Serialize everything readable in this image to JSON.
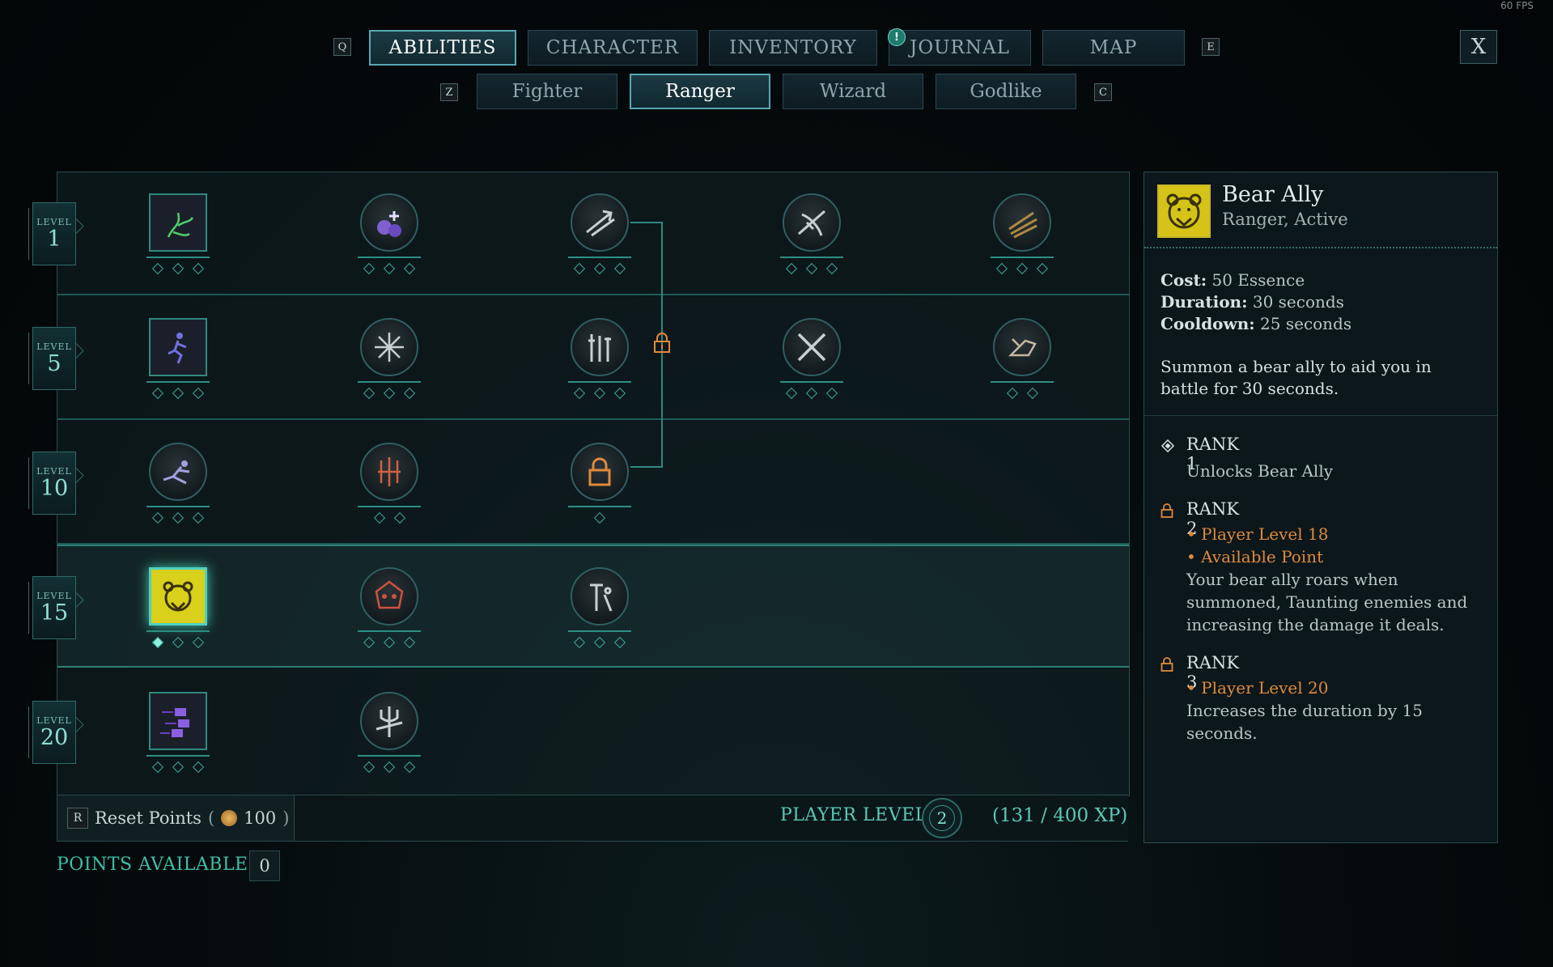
{
  "fps": "60 FPS",
  "top_tabs": {
    "left_key": "Q",
    "right_key": "E",
    "items": [
      "ABILITIES",
      "CHARACTER",
      "INVENTORY",
      "JOURNAL",
      "MAP"
    ],
    "active": "ABILITIES",
    "journal_alert": "!",
    "close_label": "X"
  },
  "class_tabs": {
    "left_key": "Z",
    "right_key": "C",
    "items": [
      "Fighter",
      "Ranger",
      "Wizard",
      "Godlike"
    ],
    "active": "Ranger"
  },
  "levels": [
    {
      "word": "LEVEL",
      "num": "1"
    },
    {
      "word": "LEVEL",
      "num": "5"
    },
    {
      "word": "LEVEL",
      "num": "10"
    },
    {
      "word": "LEVEL",
      "num": "15"
    },
    {
      "word": "LEVEL",
      "num": "20"
    }
  ],
  "abilities_rows": [
    {
      "level": "1",
      "nodes": [
        {
          "icon": "green-vine-icon",
          "shape": "square",
          "ranks": 3,
          "filled": 0
        },
        {
          "icon": "potion-bombs-icon",
          "shape": "circle",
          "ranks": 3,
          "filled": 0
        },
        {
          "icon": "arrow-volley-icon",
          "shape": "circle",
          "ranks": 3,
          "filled": 0
        },
        {
          "icon": "crossbow-icon",
          "shape": "circle",
          "ranks": 3,
          "filled": 0
        },
        {
          "icon": "claw-slash-icon",
          "shape": "circle",
          "ranks": 3,
          "filled": 0
        }
      ]
    },
    {
      "level": "5",
      "nodes": [
        {
          "icon": "dash-figure-icon",
          "shape": "square",
          "ranks": 3,
          "filled": 0
        },
        {
          "icon": "blade-burst-icon",
          "shape": "circle",
          "ranks": 3,
          "filled": 0
        },
        {
          "icon": "weapons-icon",
          "shape": "circle",
          "ranks": 3,
          "filled": 0
        },
        {
          "icon": "crossed-swords-icon",
          "shape": "circle",
          "ranks": 3,
          "filled": 0
        },
        {
          "icon": "hand-strike-icon",
          "shape": "circle",
          "ranks": 2,
          "filled": 0
        }
      ]
    },
    {
      "level": "10",
      "nodes": [
        {
          "icon": "slide-figure-icon",
          "shape": "circle",
          "ranks": 3,
          "filled": 0
        },
        {
          "icon": "triple-spear-icon",
          "shape": "circle",
          "ranks": 2,
          "filled": 0
        },
        {
          "icon": "locked-node-icon",
          "shape": "circle",
          "ranks": 1,
          "filled": 0
        }
      ]
    },
    {
      "level": "15",
      "nodes": [
        {
          "icon": "bear-icon",
          "shape": "bear",
          "ranks": 3,
          "filled": 1
        },
        {
          "icon": "beast-skull-icon",
          "shape": "circle",
          "ranks": 3,
          "filled": 0
        },
        {
          "icon": "hammer-figure-icon",
          "shape": "circle",
          "ranks": 3,
          "filled": 0
        }
      ]
    },
    {
      "level": "20",
      "nodes": [
        {
          "icon": "flurry-fists-icon",
          "shape": "square",
          "ranks": 3,
          "filled": 0
        },
        {
          "icon": "trident-icon",
          "shape": "circle",
          "ranks": 3,
          "filled": 0
        }
      ]
    }
  ],
  "bottom": {
    "reset_key": "R",
    "reset_label": "Reset Points",
    "reset_cost": "100",
    "player_level_label": "PLAYER LEVEL",
    "player_level": "2",
    "xp_text": "(131 / 400 XP)",
    "points_label": "POINTS AVAILABLE",
    "points_value": "0"
  },
  "detail": {
    "title": "Bear Ally",
    "subtitle": "Ranger, Active",
    "cost_label": "Cost:",
    "cost_value": "50 Essence",
    "duration_label": "Duration:",
    "duration_value": "30 seconds",
    "cooldown_label": "Cooldown:",
    "cooldown_value": "25 seconds",
    "description": "Summon a bear ally to aid you in battle for 30 seconds.",
    "ranks": [
      {
        "title": "RANK 1",
        "requirements": [],
        "text": "Unlocks Bear Ally"
      },
      {
        "title": "RANK 2",
        "requirements": [
          "• Player Level 18",
          "• Available Point"
        ],
        "text": "Your bear ally roars when summoned, Taunting enemies and increasing the damage it deals."
      },
      {
        "title": "RANK 3",
        "requirements": [
          "• Player Level 20"
        ],
        "text": "Increases the duration by 15 seconds."
      }
    ]
  }
}
